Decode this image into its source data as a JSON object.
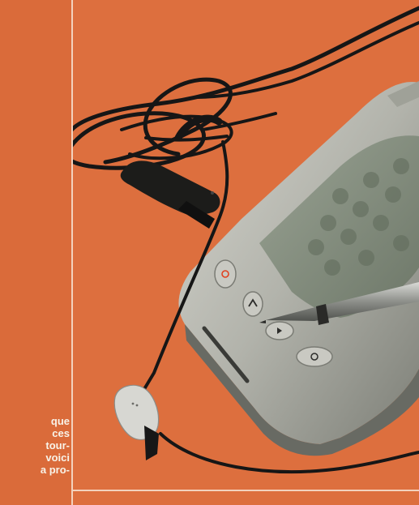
{
  "article": {
    "column_text_lines": [
      "que",
      "ces",
      "tour-",
      "voici",
      "a pro-"
    ]
  },
  "photo": {
    "subject": "headset-with-clip-microphone-and-pda-with-stylus",
    "device_buttons": [
      "power-button",
      "up-button",
      "down-button",
      "menu-button"
    ]
  },
  "colors": {
    "background": "#dd6f3e",
    "divider": "#f3d2bd",
    "text": "#f8f3e8",
    "device_body": "#b8b8b0",
    "screen": "#7f8a78",
    "cable": "#161616",
    "power_accent": "#e0411f"
  }
}
